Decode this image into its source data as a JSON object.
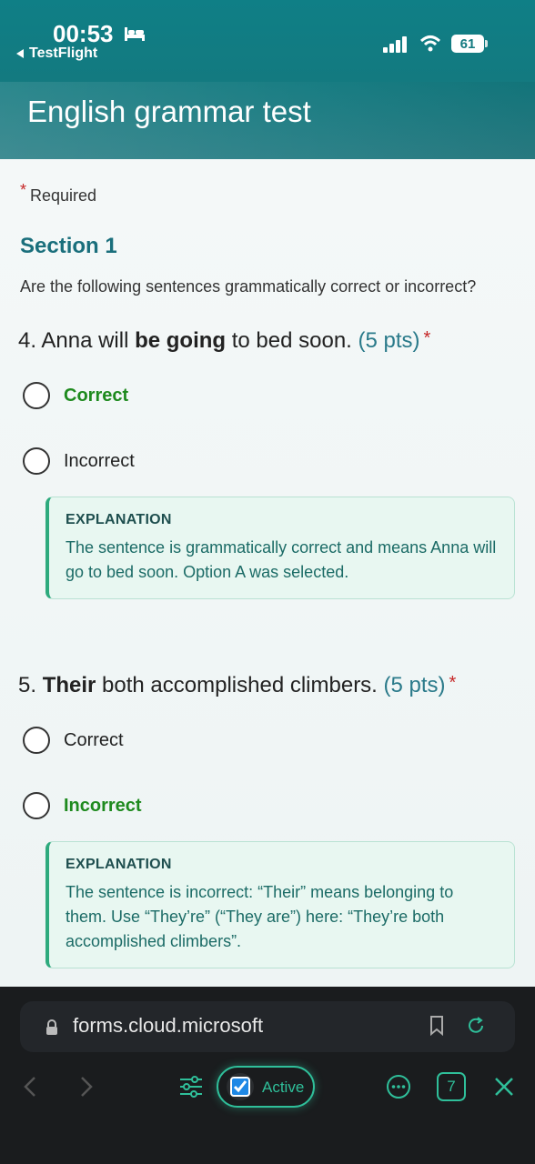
{
  "status_bar": {
    "time": "00:53",
    "back_app": "TestFlight",
    "battery": "61"
  },
  "header": {
    "title": "English grammar test"
  },
  "form": {
    "required_label": "Required",
    "required_star": "*",
    "section_title": "Section 1",
    "instruction": "Are the following sentences grammatically correct or incorrect?",
    "questions": [
      {
        "number": "4.",
        "text_before": "Anna will",
        "text_bold": "be going",
        "text_after": "to bed soon.",
        "points": "(5 pts)",
        "star": "*",
        "options": [
          "Correct",
          "Incorrect"
        ],
        "correct_option": "Correct",
        "explanation_head": "EXPLANATION",
        "explanation_body": "The sentence is grammatically correct and means Anna will go to bed soon. Option A was selected."
      },
      {
        "number": "5.",
        "text_before": "",
        "text_bold": "Their",
        "text_after": "both accomplished climbers.",
        "points": "(5 pts)",
        "star": "*",
        "options": [
          "Correct",
          "Incorrect"
        ],
        "correct_option": "Incorrect",
        "explanation_head": "EXPLANATION",
        "explanation_body": "The sentence is incorrect: “Their” means belonging to them. Use “They’re” (“They are”) here: “They’re both accomplished climbers”."
      }
    ]
  },
  "browser": {
    "url": "forms.cloud.microsoft",
    "active_label": "Active",
    "tabs_count": "7",
    "accent_color": "#2fbf9a"
  },
  "colors": {
    "header_bg": "#137a80",
    "correct_green": "#1e8a1e",
    "section_teal": "#1a6f7c",
    "required_red": "#c62828"
  }
}
